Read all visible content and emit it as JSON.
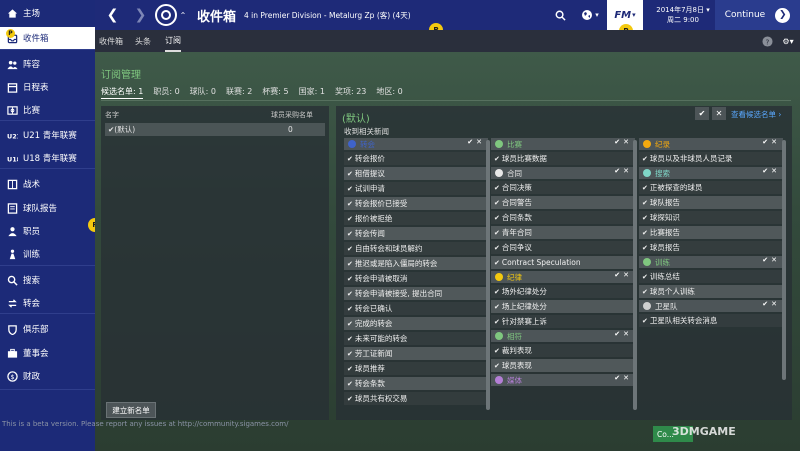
{
  "sidebar": {
    "items": [
      {
        "label": "主场",
        "icon": "home-icon",
        "active": false
      },
      {
        "label": "收件箱",
        "icon": "inbox-icon",
        "active": true
      },
      {
        "label": "阵容",
        "icon": "squad-icon",
        "active": false
      },
      {
        "label": "日程表",
        "icon": "calendar-icon",
        "active": false
      },
      {
        "label": "比赛",
        "icon": "match-icon",
        "active": false
      },
      {
        "label": "U21 青年联赛",
        "icon": "u21-icon",
        "active": false
      },
      {
        "label": "U18 青年联赛",
        "icon": "u18-icon",
        "active": false
      },
      {
        "label": "战术",
        "icon": "tactics-icon",
        "active": false
      },
      {
        "label": "球队报告",
        "icon": "team-report-icon",
        "active": false
      },
      {
        "label": "职员",
        "icon": "staff-icon",
        "active": false
      },
      {
        "label": "训练",
        "icon": "training-icon",
        "active": false
      },
      {
        "label": "搜索",
        "icon": "search-icon",
        "active": false
      },
      {
        "label": "转会",
        "icon": "transfer-icon",
        "active": false
      },
      {
        "label": "俱乐部",
        "icon": "club-icon",
        "active": false
      },
      {
        "label": "董事会",
        "icon": "board-icon",
        "active": false
      },
      {
        "label": "财政",
        "icon": "finance-icon",
        "active": false
      }
    ],
    "beta_notice": "This is a beta version. Please report any issues at http://community.sigames.com/",
    "help_badge": "P"
  },
  "topbar": {
    "title": "收件箱",
    "subtitle": "4 in Premier Division - Metalurg Zp (客) (4天)",
    "date_line1": "2014年7月8日 ▾",
    "date_line2": "周二 9:00",
    "continue_label": "Continue",
    "fm_label": "FM",
    "badge": "P"
  },
  "subtabs": [
    "收件箱",
    "头条",
    "订阅"
  ],
  "subtabs_active": 2,
  "subscription": {
    "section_title": "订阅管理",
    "filters": [
      {
        "label": "候选名单: 1",
        "active": true
      },
      {
        "label": "职员: 0",
        "active": false
      },
      {
        "label": "球队: 0",
        "active": false
      },
      {
        "label": "联赛: 2",
        "active": false
      },
      {
        "label": "杯赛: 5",
        "active": false
      },
      {
        "label": "国家: 1",
        "active": false
      },
      {
        "label": "奖项: 23",
        "active": false
      },
      {
        "label": "地区: 0",
        "active": false
      }
    ],
    "left": {
      "col_name": "名字",
      "col_count": "球员采购名单",
      "rows": [
        {
          "name": "(默认)",
          "count": "0"
        }
      ],
      "create_button": "建立新名单",
      "badge": "P"
    },
    "right": {
      "title": "(默认)",
      "subtitle": "收到相关新闻",
      "view_candidates": "查看候选名单 ›",
      "col1": [
        {
          "name": "转会",
          "color": "#3f63c9",
          "items": [
            "转会报价",
            "租借提议",
            "试训申请",
            "转会报价已接受",
            "报价被拒绝",
            "转会传闻",
            "自由转会和球员解约",
            "推迟或是陷入僵局的转会",
            "转会申请被取消",
            "转会申请被接受, 提出合同",
            "转会已确认",
            "完成的转会",
            "未来可能的转会",
            "劳工证新闻",
            "球员推荐",
            "转会条款",
            "球员共有权交易"
          ]
        }
      ],
      "col2": [
        {
          "name": "比赛",
          "color": "#7fc77f",
          "items": [
            "球员比赛数据"
          ]
        },
        {
          "name": "合同",
          "color": "#e8e8e8",
          "items": [
            "合同决策",
            "合同警告",
            "合同条款",
            "青年合同",
            "合同争议",
            "Contract Speculation"
          ]
        },
        {
          "name": "纪律",
          "color": "#f3c90f",
          "items": [
            "场外纪律处分",
            "场上纪律处分",
            "针对禁赛上诉"
          ]
        },
        {
          "name": "相符",
          "color": "#7fc77f",
          "items": [
            "裁判表现",
            "球员表现"
          ]
        },
        {
          "name": "媒体",
          "color": "#b47fd6",
          "items": []
        }
      ],
      "col3": [
        {
          "name": "纪录",
          "color": "#f3a90f",
          "items": [
            "球员以及非球员人员记录"
          ]
        },
        {
          "name": "搜索",
          "color": "#7fd6c7",
          "items": [
            "正被探查的球员",
            "球队报告",
            "球探知识",
            "比赛报告",
            "球员报告"
          ]
        },
        {
          "name": "训练",
          "color": "#7fc77f",
          "items": [
            "训练总结",
            "球员个人训练"
          ]
        },
        {
          "name": "卫星队",
          "color": "#cfcfcf",
          "items": [
            "卫星队相关转会消息"
          ]
        }
      ]
    }
  },
  "corner_button": "Co...",
  "watermark": "3DMGAME"
}
